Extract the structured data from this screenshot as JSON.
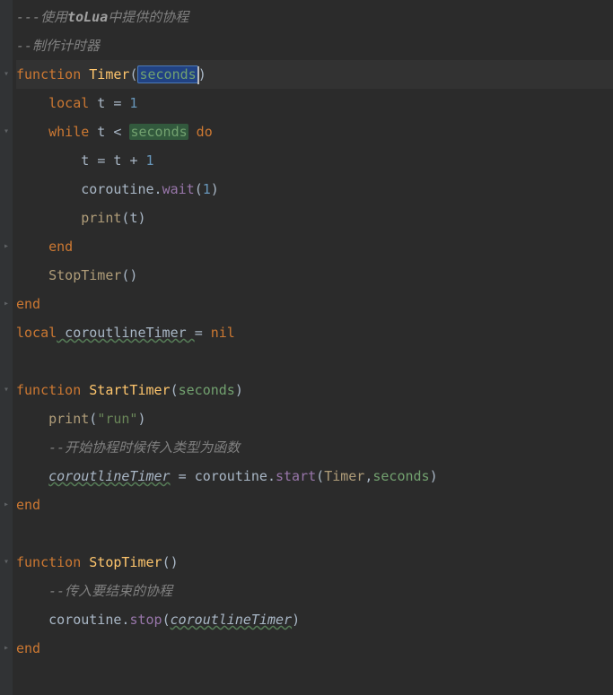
{
  "code": {
    "l1_a": "---使用",
    "l1_b": "toLua",
    "l1_c": "中提供的协程",
    "l2": "--制作计时器",
    "l3_fn": "function",
    "l3_name": " Timer",
    "l3_op": "(",
    "l3_param": "seconds",
    "l3_cp": ")",
    "l4_local": "local",
    "l4_var": " t ",
    "l4_eq": "=",
    "l4_num": " 1",
    "l5_while": "while",
    "l5_mid": " t < ",
    "l5_param": "seconds",
    "l5_do": " do",
    "l6_a": "t ",
    "l6_eq": "=",
    "l6_b": " t ",
    "l6_plus": "+",
    "l6_num": " 1",
    "l7_obj": "coroutine",
    "l7_dot": ".",
    "l7_wait": "wait",
    "l7_op": "(",
    "l7_num": "1",
    "l7_cp": ")",
    "l8_print": "print",
    "l8_op": "(",
    "l8_t": "t",
    "l8_cp": ")",
    "l9_end": "end",
    "l10_stop": "StopTimer",
    "l10_p": "()",
    "l11_end": "end",
    "l12_local": "local",
    "l12_var": " coroutlineTimer ",
    "l12_eq": "=",
    "l12_nil": " nil",
    "l14_fn": "function",
    "l14_name": " StartTimer",
    "l14_op": "(",
    "l14_param": "seconds",
    "l14_cp": ")",
    "l15_print": "print",
    "l15_op": "(",
    "l15_str": "\"run\"",
    "l15_cp": ")",
    "l16": "--开始协程时候传入类型为函数",
    "l17_var": "coroutlineTimer",
    "l17_eq": " = ",
    "l17_obj": "coroutine",
    "l17_dot": ".",
    "l17_start": "start",
    "l17_op": "(",
    "l17_timer": "Timer",
    "l17_comma": ",",
    "l17_param": "seconds",
    "l17_cp": ")",
    "l18_end": "end",
    "l20_fn": "function",
    "l20_name": " StopTimer",
    "l20_p": "()",
    "l21": "--传入要结束的协程",
    "l22_obj": "coroutine",
    "l22_dot": ".",
    "l22_stop": "stop",
    "l22_op": "(",
    "l22_var": "coroutlineTimer",
    "l22_cp": ")",
    "l23_end": "end"
  },
  "indent1": "    ",
  "indent2": "        "
}
